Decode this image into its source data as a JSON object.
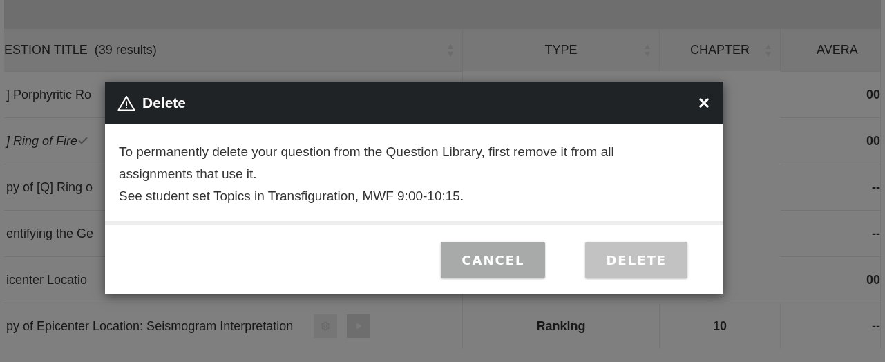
{
  "table": {
    "columns": [
      {
        "label": "ESTION TITLE",
        "count": "(39 results)",
        "sortable": true
      },
      {
        "label": "TYPE",
        "sortable": true
      },
      {
        "label": "CHAPTER",
        "sortable": true
      },
      {
        "label": "AVERA",
        "sortable": false
      }
    ],
    "rows": [
      {
        "title": "] Porphyritic Ro",
        "italic": false,
        "verified": false,
        "average": "00"
      },
      {
        "title": "] Ring of Fire",
        "italic": true,
        "verified": true,
        "average": "00"
      },
      {
        "title": "py of [Q] Ring o",
        "italic": false,
        "verified": false,
        "average": "--"
      },
      {
        "title": "entifying the Ge",
        "italic": false,
        "verified": false,
        "average": "--"
      },
      {
        "title": "icenter Locatio",
        "italic": false,
        "verified": false,
        "average": "00"
      },
      {
        "title": "py of Epicenter Location: Seismogram Interpretation",
        "italic": false,
        "verified": false,
        "actions": true,
        "type": "Ranking",
        "chapter": "10",
        "average": "--"
      }
    ]
  },
  "modal": {
    "title": "Delete",
    "paragraphs": [
      "To permanently delete your question from the Question Library, first remove it from all assignments that use it.",
      "See student set Topics in Transfiguration, MWF 9:00-10:15."
    ],
    "buttons": [
      {
        "label": "CANCEL",
        "disabled": false
      },
      {
        "label": "DELETE",
        "disabled": true
      }
    ]
  }
}
